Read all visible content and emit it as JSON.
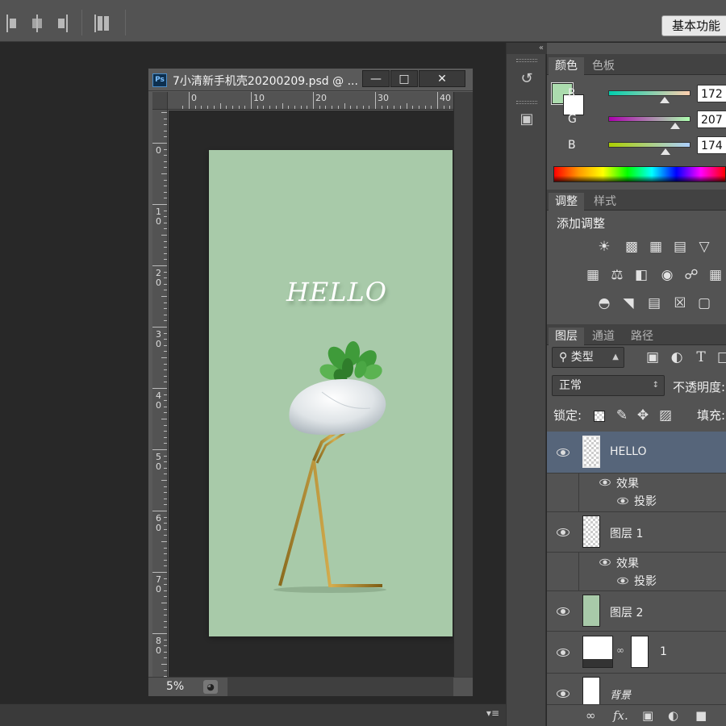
{
  "app": {
    "workspace_button": "基本功能"
  },
  "document": {
    "title": "7小清新手机壳20200209.psd @ ...",
    "ps_badge": "Ps",
    "zoom": "5%",
    "ruler_top_labels": [
      "0",
      "10",
      "20",
      "30",
      "40"
    ],
    "ruler_left_labels": [
      [
        "0"
      ],
      [
        "1",
        "0"
      ],
      [
        "2",
        "0"
      ],
      [
        "3",
        "0"
      ],
      [
        "4",
        "0"
      ],
      [
        "5",
        "0"
      ],
      [
        "6",
        "0"
      ],
      [
        "7",
        "0"
      ],
      [
        "8",
        "0"
      ]
    ],
    "canvas_text": "HELLO",
    "artboard_color": "#a8caa9"
  },
  "color_panel": {
    "tabs": [
      "颜色",
      "色板"
    ],
    "fg_color": "#acdcae",
    "bg_color": "#ffffff",
    "channels": [
      {
        "label": "R",
        "value": "172"
      },
      {
        "label": "G",
        "value": "207"
      },
      {
        "label": "B",
        "value": "174"
      }
    ]
  },
  "adjust_panel": {
    "tabs": [
      "调整",
      "样式"
    ],
    "title": "添加调整"
  },
  "layers_panel": {
    "tabs": [
      "图层",
      "通道",
      "路径"
    ],
    "filter_kind": "类型",
    "blend_mode": "正常",
    "opacity_label": "不透明度:",
    "lock_label": "锁定:",
    "fill_label": "填充:",
    "layers": [
      {
        "name": "HELLO",
        "effects_label": "效果",
        "effect": "投影"
      },
      {
        "name": "图层 1",
        "effects_label": "效果",
        "effect": "投影"
      },
      {
        "name": "图层 2"
      },
      {
        "name": "1"
      },
      {
        "name": "背景"
      }
    ]
  }
}
